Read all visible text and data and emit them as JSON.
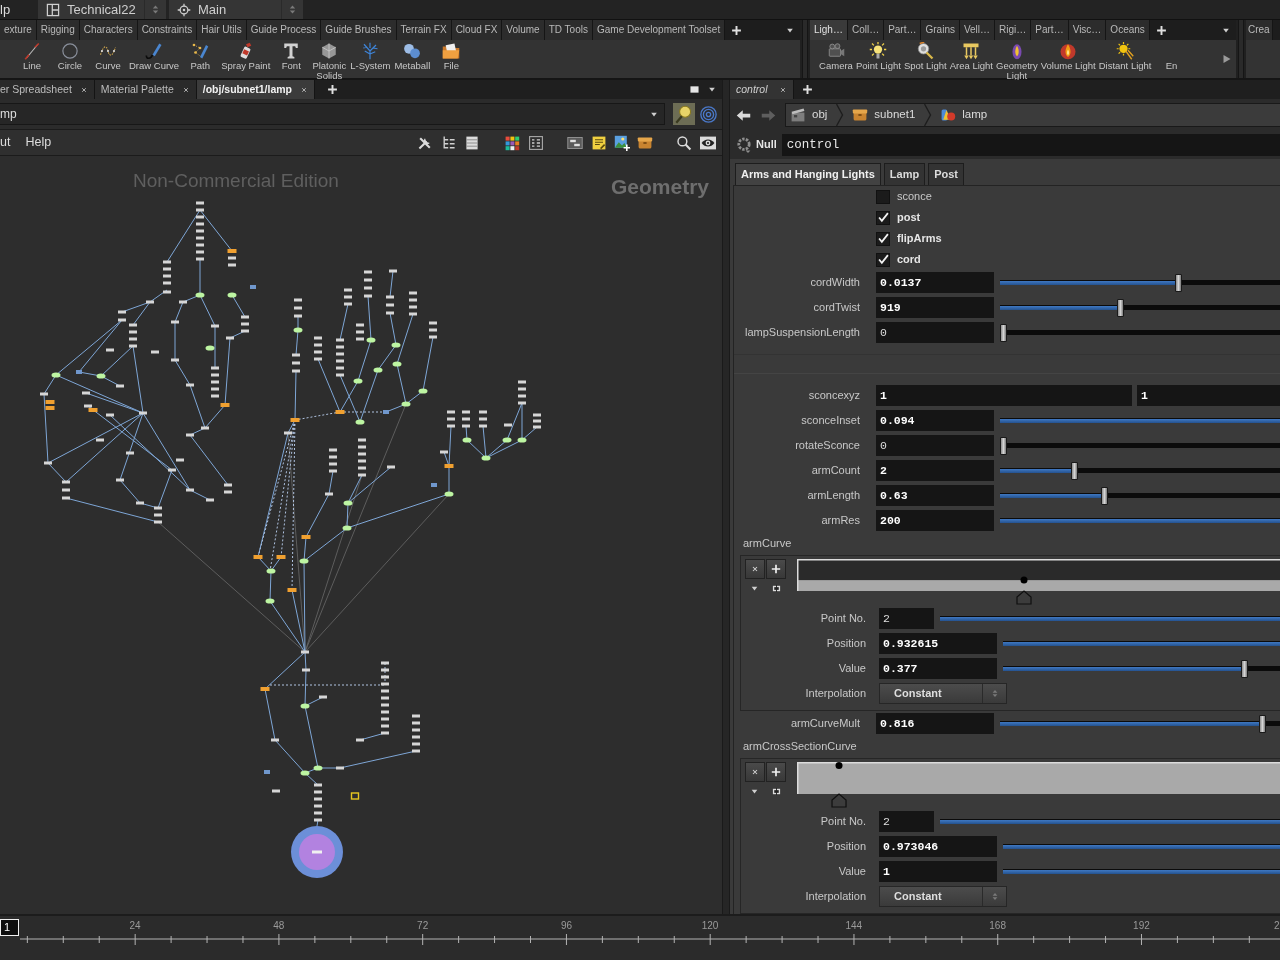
{
  "menu_bar": {
    "menu_item": "lp",
    "desktop": "Technical22",
    "context": "Main"
  },
  "shelves": [
    {
      "tabs": [
        {
          "label": "exture",
          "selected": false
        },
        {
          "label": "Rigging",
          "selected": false
        },
        {
          "label": "Characters",
          "selected": false
        },
        {
          "label": "Constraints",
          "selected": false
        },
        {
          "label": "Hair Utils",
          "selected": false
        },
        {
          "label": "Guide Process",
          "selected": false
        },
        {
          "label": "Guide Brushes",
          "selected": false
        },
        {
          "label": "Terrain FX",
          "selected": false
        },
        {
          "label": "Cloud FX",
          "selected": false
        },
        {
          "label": "Volume",
          "selected": false
        },
        {
          "label": "TD Tools",
          "selected": false
        },
        {
          "label": "Game Development Toolset",
          "selected": false
        }
      ],
      "tools": [
        {
          "label": "Line"
        },
        {
          "label": "Circle"
        },
        {
          "label": "Curve"
        },
        {
          "label": "Draw Curve"
        },
        {
          "label": "Path"
        },
        {
          "label": "Spray Paint"
        },
        {
          "label": "Font"
        },
        {
          "label": "Platonic\nSolids"
        },
        {
          "label": "L-System"
        },
        {
          "label": "Metaball"
        },
        {
          "label": "File"
        }
      ],
      "more_tools": false
    },
    {
      "tabs": [
        {
          "label": "Ligh…",
          "selected": true
        },
        {
          "label": "Coll…",
          "selected": false
        },
        {
          "label": "Part…",
          "selected": false
        },
        {
          "label": "Grains",
          "selected": false
        },
        {
          "label": "Vell…",
          "selected": false
        },
        {
          "label": "Rigi…",
          "selected": false
        },
        {
          "label": "Part…",
          "selected": false
        },
        {
          "label": "Visc…",
          "selected": false
        },
        {
          "label": "Oceans",
          "selected": false
        }
      ],
      "tools": [
        {
          "label": "Camera"
        },
        {
          "label": "Point Light"
        },
        {
          "label": "Spot Light"
        },
        {
          "label": "Area Light"
        },
        {
          "label": "Geometry\nLight"
        },
        {
          "label": "Volume Light"
        },
        {
          "label": "Distant Light"
        },
        {
          "label": "En"
        }
      ],
      "more_tools": true
    },
    {
      "tabs": [
        {
          "label": "Crea",
          "selected": false
        }
      ]
    }
  ],
  "network_pane": {
    "tabs": [
      {
        "label": "er Spreadsheet",
        "selected": false
      },
      {
        "label": "Material Palette",
        "selected": false
      },
      {
        "label": "/obj/subnet1/lamp",
        "selected": true
      }
    ],
    "path": "mp",
    "menus": [
      "ut",
      "Help"
    ],
    "license_notice": "Non-Commercial Edition",
    "network_type": "Geometry"
  },
  "parameter_pane": {
    "tabs": [
      {
        "label": "control",
        "selected": true
      }
    ],
    "breadcrumb": [
      "obj",
      "subnet1",
      "lamp"
    ],
    "node_type": "Null",
    "node_name": "control",
    "folders": [
      {
        "label": "Arms and Hanging Lights",
        "selected": true
      },
      {
        "label": "Lamp",
        "selected": false
      },
      {
        "label": "Post",
        "selected": false
      }
    ],
    "parameters": [
      {
        "kind": "toggle",
        "label": "sconce",
        "checked": false,
        "modified": false
      },
      {
        "kind": "toggle",
        "label": "post",
        "checked": true,
        "modified": true
      },
      {
        "kind": "toggle",
        "label": "flipArms",
        "checked": true,
        "modified": true
      },
      {
        "kind": "toggle",
        "label": "cord",
        "checked": true,
        "modified": true
      },
      {
        "kind": "slider",
        "label": "cordWidth",
        "value": "0.0137",
        "modified": true,
        "level": 0.64
      },
      {
        "kind": "slider",
        "label": "cordTwist",
        "value": "919",
        "modified": true,
        "level": 0.43
      },
      {
        "kind": "slider",
        "label": "lampSuspensionLength",
        "value": "0",
        "modified": false,
        "level": 0
      },
      {
        "kind": "separator"
      },
      {
        "kind": "vector",
        "label": "sconcexyz",
        "values": [
          "1",
          "1"
        ],
        "modified": true
      },
      {
        "kind": "slider",
        "label": "sconceInset",
        "value": "0.094",
        "modified": true,
        "level": 1
      },
      {
        "kind": "slider",
        "label": "rotateSconce",
        "value": "0",
        "modified": false,
        "level": 0
      },
      {
        "kind": "slider",
        "label": "armCount",
        "value": "2",
        "modified": true,
        "level": 0.26
      },
      {
        "kind": "slider",
        "label": "armLength",
        "value": "0.63",
        "modified": true,
        "level": 0.37
      },
      {
        "kind": "slider",
        "label": "armRes",
        "value": "200",
        "modified": true,
        "level": 1
      },
      {
        "kind": "ramp",
        "label": "armCurve",
        "points": [
          {
            "kind": "index",
            "label": "Point No.",
            "value": "2",
            "modified": false,
            "level": 1
          },
          {
            "kind": "slider",
            "label": "Position",
            "value": "0.932615",
            "modified": true,
            "level": 1
          },
          {
            "kind": "slider",
            "label": "Value",
            "value": "0.377",
            "modified": true,
            "level": 0.88
          },
          {
            "kind": "menu",
            "label": "Interpolation",
            "value": "Constant"
          }
        ]
      },
      {
        "kind": "slider",
        "label": "armCurveMult",
        "value": "0.816",
        "modified": true,
        "level": 0.95
      },
      {
        "kind": "ramp",
        "label": "armCrossSectionCurve",
        "points": [
          {
            "kind": "index",
            "label": "Point No.",
            "value": "2",
            "modified": false,
            "level": 1
          },
          {
            "kind": "slider",
            "label": "Position",
            "value": "0.973046",
            "modified": true,
            "level": 1
          },
          {
            "kind": "slider",
            "label": "Value",
            "value": "1",
            "modified": true,
            "level": 1
          },
          {
            "kind": "menu",
            "label": "Interpolation",
            "value": "Constant"
          }
        ]
      }
    ]
  },
  "timeline": {
    "frame": "1",
    "ruler_labels": [
      "24",
      "48",
      "72",
      "96",
      "120",
      "144",
      "168",
      "192",
      "2"
    ]
  }
}
